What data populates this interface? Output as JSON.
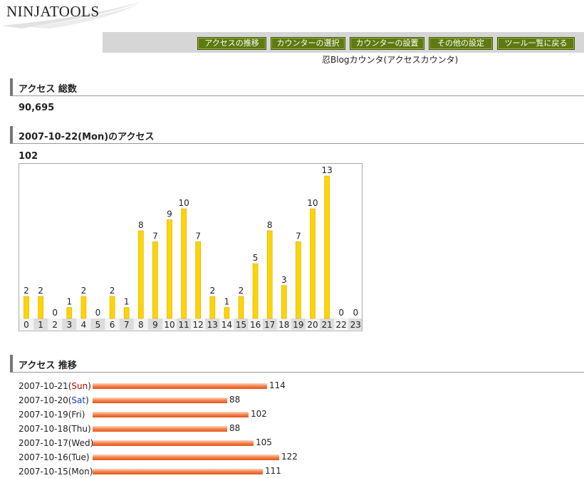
{
  "logo": {
    "text": "NINJATOOLS"
  },
  "nav": {
    "items": [
      "アクセスの推移",
      "カウンターの選択",
      "カウンターの設置",
      "その他の設定",
      "ツール一覧に戻る"
    ]
  },
  "subtitle": "忍Blogカウンタ(アクセスカウンタ)",
  "total": {
    "heading": "アクセス 総数",
    "value": "90,695"
  },
  "daily": {
    "heading": "2007-10-22(Mon)のアクセス",
    "value": "102"
  },
  "history": {
    "heading": "アクセス 推移",
    "rows": [
      {
        "date": "2007-10-21(",
        "day": "Sun",
        "close": ")",
        "kind": "sun",
        "value": 114
      },
      {
        "date": "2007-10-20(",
        "day": "Sat",
        "close": ")",
        "kind": "sat",
        "value": 88
      },
      {
        "date": "2007-10-19(",
        "day": "Fri",
        "close": ")",
        "kind": "",
        "value": 102
      },
      {
        "date": "2007-10-18(",
        "day": "Thu",
        "close": ")",
        "kind": "",
        "value": 88
      },
      {
        "date": "2007-10-17(",
        "day": "Wed",
        "close": ")",
        "kind": "",
        "value": 105
      },
      {
        "date": "2007-10-16(",
        "day": "Tue",
        "close": ")",
        "kind": "",
        "value": 122
      },
      {
        "date": "2007-10-15(",
        "day": "Mon",
        "close": ")",
        "kind": "",
        "value": 111
      }
    ]
  },
  "chart_data": {
    "type": "bar",
    "categories": [
      "0",
      "1",
      "2",
      "3",
      "4",
      "5",
      "6",
      "7",
      "8",
      "9",
      "10",
      "11",
      "12",
      "13",
      "14",
      "15",
      "16",
      "17",
      "18",
      "19",
      "20",
      "21",
      "22",
      "23"
    ],
    "values": [
      2,
      2,
      0,
      1,
      2,
      0,
      2,
      1,
      8,
      7,
      9,
      10,
      7,
      2,
      1,
      2,
      5,
      8,
      3,
      7,
      10,
      13,
      0,
      0
    ],
    "title": "",
    "xlabel": "",
    "ylabel": "",
    "ylim": [
      0,
      13
    ],
    "grid": false,
    "colors": {
      "bar": "#ffd400",
      "bar_edge": "#d9a800",
      "axis_alt": "#dcdcdc"
    }
  }
}
